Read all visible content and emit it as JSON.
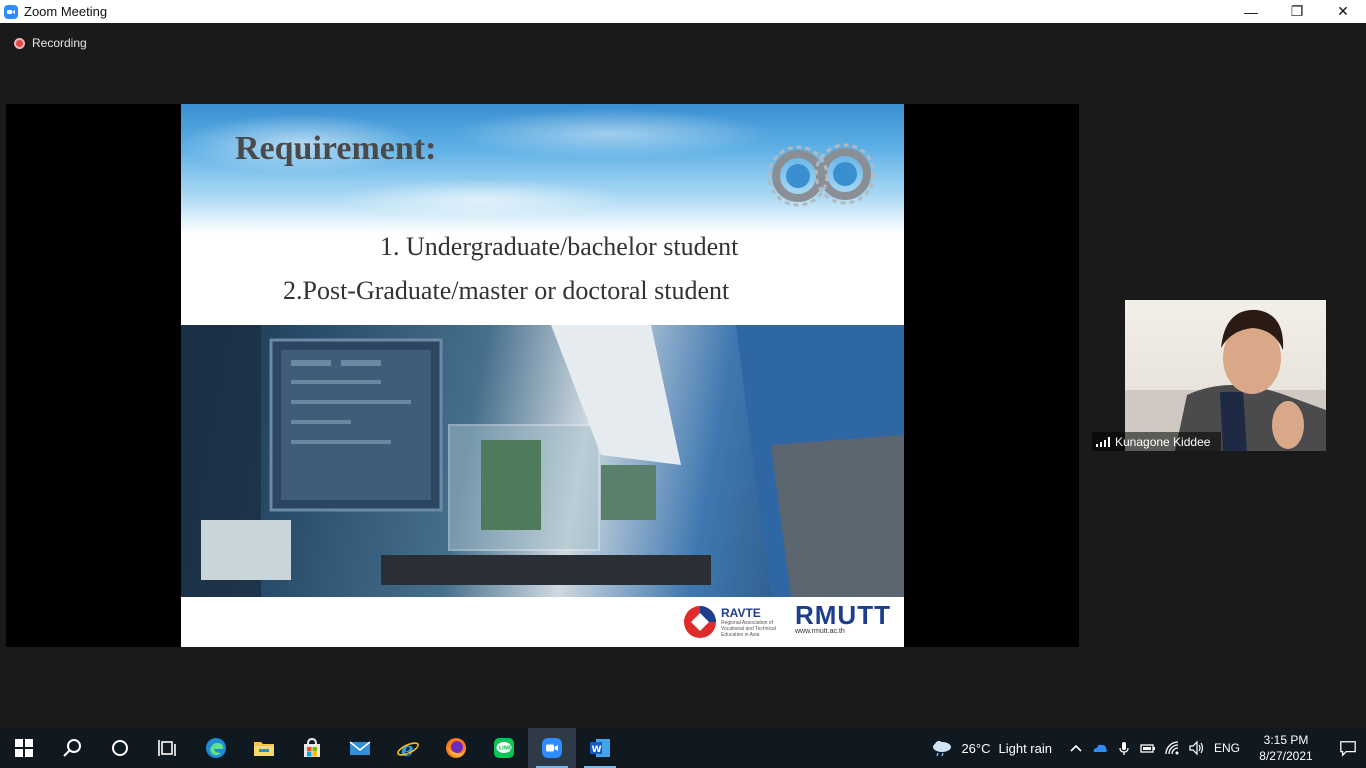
{
  "window": {
    "title": "Zoom Meeting",
    "controls": {
      "minimize": "—",
      "restore": "❐",
      "close": "✕"
    }
  },
  "meeting": {
    "recording_label": "Recording",
    "participant_name": "Kunagone Kiddee"
  },
  "slide": {
    "title": "Requirement:",
    "items": [
      "1. Undergraduate/bachelor student",
      "2.Post-Graduate/master or doctoral student"
    ],
    "logos": {
      "ravte_name": "RAVTE",
      "ravte_subtitle": "Regional Association of Vocational and Technical Education in Asia",
      "rmutt_name": "RMUTT",
      "rmutt_url": "www.rmutt.ac.th"
    }
  },
  "taskbar": {
    "apps": [
      "windows-start",
      "search",
      "cortana",
      "task-view",
      "edge",
      "file-explorer",
      "store",
      "mail",
      "internet-explorer",
      "firefox",
      "line",
      "zoom",
      "word"
    ],
    "weather": {
      "temp": "26°C",
      "condition": "Light rain"
    },
    "language": "ENG",
    "time": "3:15 PM",
    "date": "8/27/2021"
  },
  "colors": {
    "zoom_blue": "#2d8cff",
    "taskbar_bg": "#101820",
    "meeting_bg": "#1a1a1a",
    "rec_red": "#e04848"
  }
}
